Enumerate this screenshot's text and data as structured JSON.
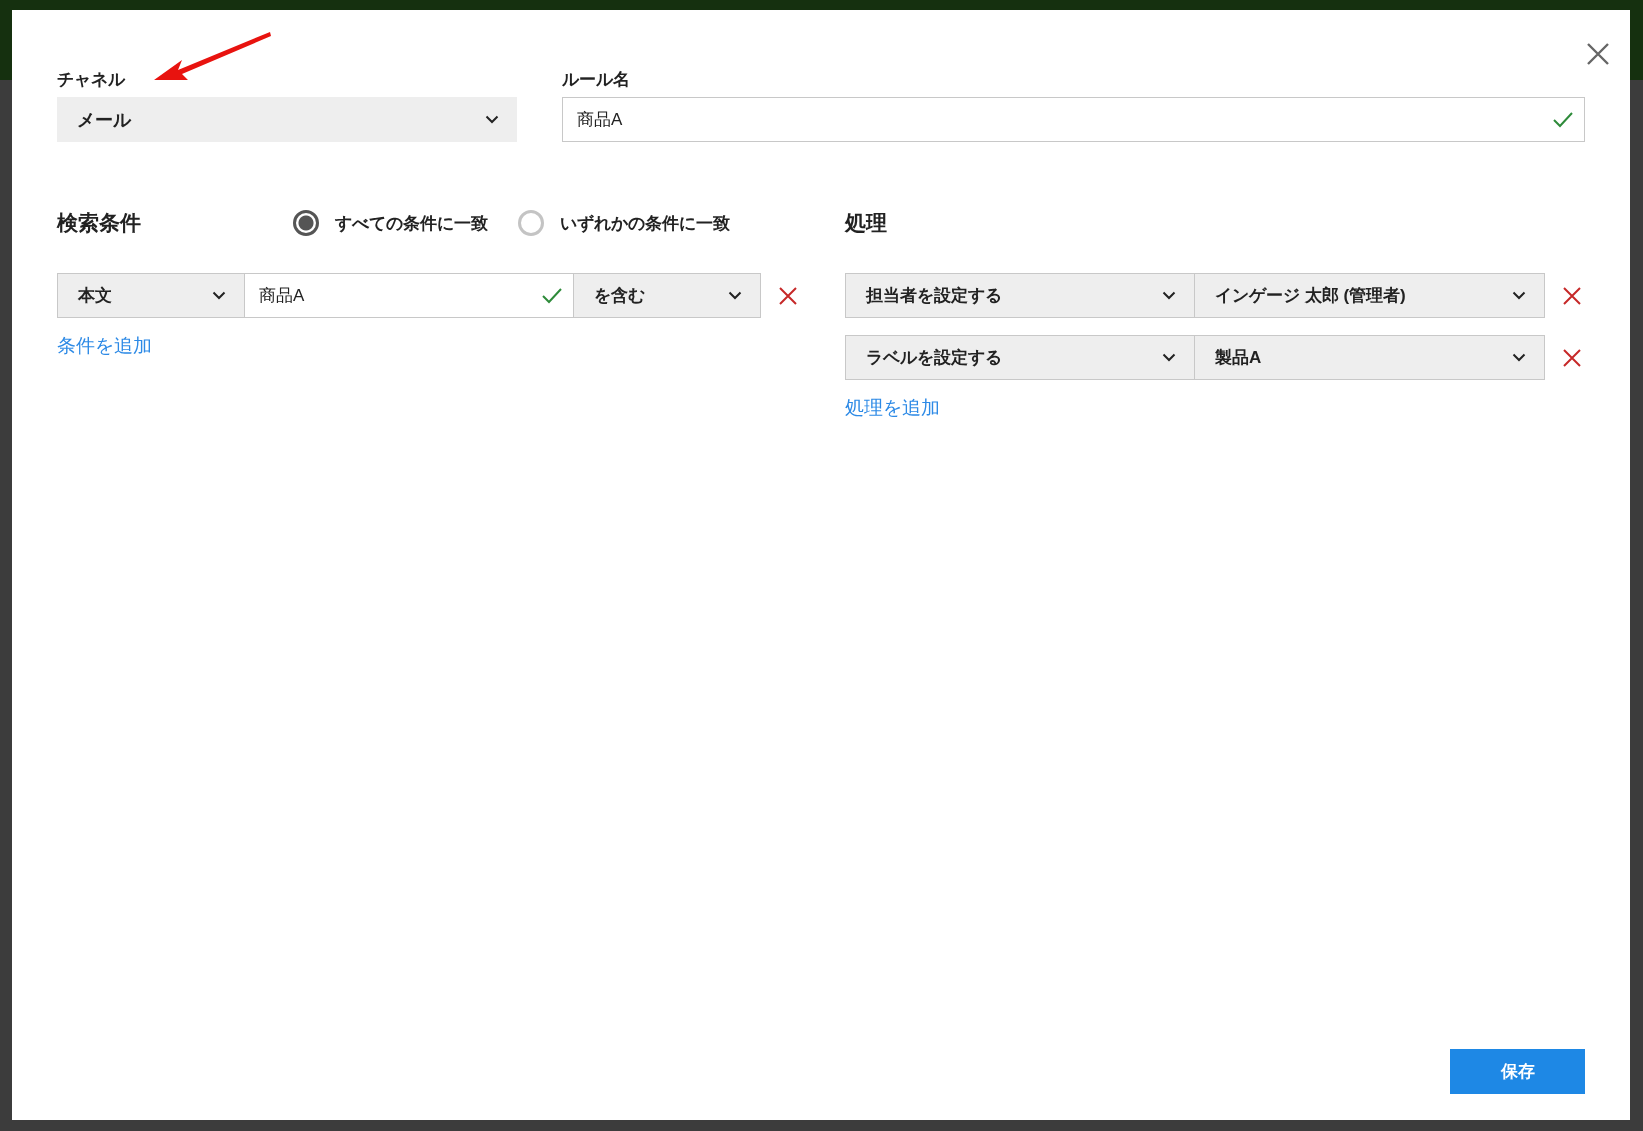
{
  "channel": {
    "label": "チャネル",
    "value": "メール"
  },
  "rule_name": {
    "label": "ルール名",
    "value": "商品A",
    "valid": true
  },
  "conditions": {
    "title": "検索条件",
    "match_options": [
      {
        "label": "すべての条件に一致",
        "selected": true
      },
      {
        "label": "いずれかの条件に一致",
        "selected": false
      }
    ],
    "rows": [
      {
        "field": "本文",
        "value": "商品A",
        "valid": true,
        "operator": "を含む"
      }
    ],
    "add_link": "条件を追加"
  },
  "actions": {
    "title": "処理",
    "rows": [
      {
        "action": "担当者を設定する",
        "value": "インゲージ 太郎 (管理者)"
      },
      {
        "action": "ラベルを設定する",
        "value": "製品A"
      }
    ],
    "add_link": "処理を追加"
  },
  "save_button": "保存"
}
